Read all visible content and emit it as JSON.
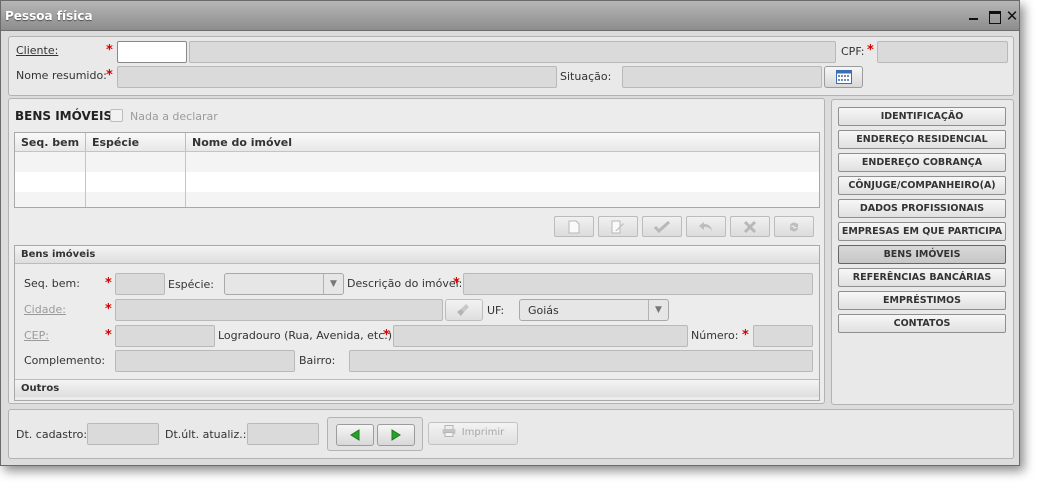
{
  "window": {
    "title": "Pessoa física"
  },
  "client": {
    "cliente_label": "Cliente:",
    "cpf_label": "CPF:",
    "nome_resumido_label": "Nome resumido:",
    "situacao_label": "Situação:"
  },
  "bens": {
    "title": "BENS IMÓVEIS",
    "nada_label": "Nada a declarar",
    "columns": [
      "Seq. bem",
      "Espécie",
      "Nome do imóvel"
    ]
  },
  "form": {
    "section_title": "Bens imóveis",
    "seq_label": "Seq. bem:",
    "especie_label": "Espécie:",
    "descricao_label": "Descrição do imóvel:",
    "cidade_label": "Cidade:",
    "uf_label": "UF:",
    "uf_value": "Goiás",
    "cep_label": "CEP:",
    "logradouro_label": "Logradouro (Rua, Avenida, etc.):",
    "numero_label": "Número:",
    "complemento_label": "Complemento:",
    "bairro_label": "Bairro:",
    "outros_label": "Outros"
  },
  "side_menu": [
    "IDENTIFICAÇÃO",
    "ENDEREÇO RESIDENCIAL",
    "ENDEREÇO COBRANÇA",
    "CÔNJUGE/COMPANHEIRO(A)",
    "DADOS PROFISSIONAIS",
    "EMPRESAS EM QUE PARTICIPA",
    "BENS IMÓVEIS",
    "REFERÊNCIAS BANCÁRIAS",
    "EMPRÉSTIMOS",
    "CONTATOS"
  ],
  "footer": {
    "dt_cadastro_label": "Dt. cadastro:",
    "dt_atualiz_label": "Dt.últ. atualiz.:",
    "imprimir_label": "Imprimir"
  },
  "icons": {
    "new": "document-icon",
    "edit": "edit-icon",
    "save": "check-icon",
    "undo": "undo-icon",
    "delete": "x-icon",
    "refresh": "refresh-icon",
    "calendar": "calendar-icon",
    "prev": "arrow-left-icon",
    "next": "arrow-right-icon",
    "print": "printer-icon"
  },
  "colors": {
    "required": "#d60000",
    "nav_arrow": "#2aa02a"
  }
}
